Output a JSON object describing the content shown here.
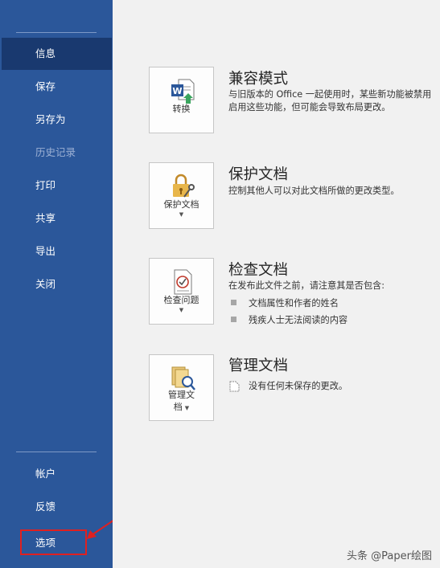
{
  "sidebar": {
    "items": [
      {
        "label": "信息"
      },
      {
        "label": "保存"
      },
      {
        "label": "另存为"
      },
      {
        "label": "历史记录"
      },
      {
        "label": "打印"
      },
      {
        "label": "共享"
      },
      {
        "label": "导出"
      },
      {
        "label": "关闭"
      }
    ],
    "bottom_items": [
      {
        "label": "帐户"
      },
      {
        "label": "反馈"
      },
      {
        "label": "选项"
      }
    ]
  },
  "sections": [
    {
      "title": "兼容模式",
      "tile_label": "转换",
      "desc": [
        "与旧版本的 Office 一起使用时，某些新功能被禁用",
        "启用这些功能，但可能会导致布局更改。"
      ]
    },
    {
      "title": "保护文档",
      "tile_label": "保护文档",
      "desc": [
        "控制其他人可以对此文档所做的更改类型。"
      ]
    },
    {
      "title": "检查文档",
      "tile_label": "检查问题",
      "desc": [
        "在发布此文件之前，请注意其是否包含:"
      ],
      "bullets": [
        "文档属性和作者的姓名",
        "残疾人士无法阅读的内容"
      ]
    },
    {
      "title": "管理文档",
      "tile_label_lines": [
        "管理文",
        "档"
      ],
      "desc": [
        "没有任何未保存的更改。"
      ]
    }
  ],
  "watermark": "头条 @Paper绘图",
  "colors": {
    "sidebar": "#2b579a",
    "active": "#19396f",
    "highlight": "#e02020"
  }
}
